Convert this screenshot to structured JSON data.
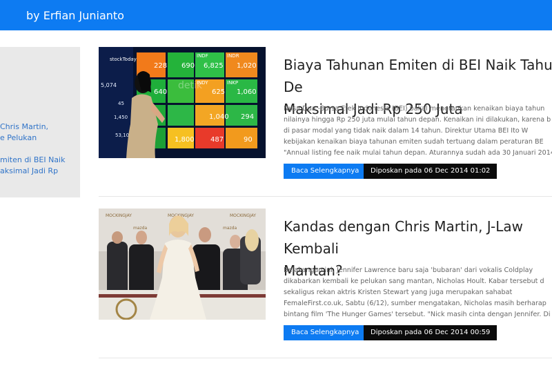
{
  "header": {
    "brand": "by Erfian Junianto"
  },
  "sidebar": {
    "links": [
      {
        "line1": "Chris Martin,",
        "line2": "e Pelukan"
      },
      {
        "line1": "miten di BEI Naik",
        "line2": "aksimal Jadi Rp"
      }
    ]
  },
  "posts": [
    {
      "title_line1": "Biaya Tahunan Emiten di BEI Naik Tahun De",
      "title_line2": "Maksimal Jadi Rp 250 Juta",
      "excerpt_lines": [
        "Nusa Dua -Bursa Efek Indonesia (BEI) bakal menerapkan kenaikan biaya tahun",
        "nilainya hingga Rp 250 juta mulai tahun depan. Kenaikan ini dilakukan, karena b",
        "di pasar modal yang tidak naik dalam 14 tahun. Direktur Utama BEI Ito W",
        "kebijakan kenaikan biaya tahunan emiten sudah tertuang dalam peraturan BE",
        "\"Annual listing fee naik mulai tahun depan. Aturannya sudah ada 30 Januari 2014"
      ],
      "read_more": "Baca Selengkapnya",
      "posted": "Diposkan pada 06 Dec 2014 01:02",
      "image_text": {
        "brand": "stockToday",
        "watermark": "detik"
      }
    },
    {
      "title_line1": "Kandas dengan Chris Martin, J-Law Kembali",
      "title_line2": "Mantan?",
      "excerpt_lines": [
        "Belakangan ini, Jennifer Lawrence baru saja 'bubaran' dari vokalis Coldplay",
        "dikabarkan kembali ke pelukan sang mantan, Nicholas Hoult. Kabar tersebut d",
        "sekaligus rekan aktris Kristen Stewart yang juga merupakan sahabat",
        "FemaleFirst.co.uk, Sabtu (6/12), sumber mengatakan, Nicholas masih berharap",
        "bintang film 'The Hunger Games' tersebut. \"Nick masih cinta dengan Jennifer. Di"
      ],
      "read_more": "Baca Selengkapnya",
      "posted": "Diposkan pada 06 Dec 2014 00:59",
      "image_text": {
        "brand": "mazda",
        "banner": "MOCKINGJAY"
      }
    }
  ],
  "ticker": {
    "labels": [
      "INDF",
      "INDR",
      "INDY",
      "INKP"
    ],
    "values": [
      "228",
      "690",
      "6,825",
      "1,020",
      "640",
      "625",
      "1,060",
      "1,040",
      "294",
      "1,800",
      "487",
      "90"
    ],
    "left_values": [
      "5,074",
      "45",
      "1,450",
      "53,101"
    ]
  },
  "colors": {
    "accent": "#0d7bf2",
    "dark_button": "#0b0b0b",
    "sidebar_bg": "#e9e9e9"
  }
}
